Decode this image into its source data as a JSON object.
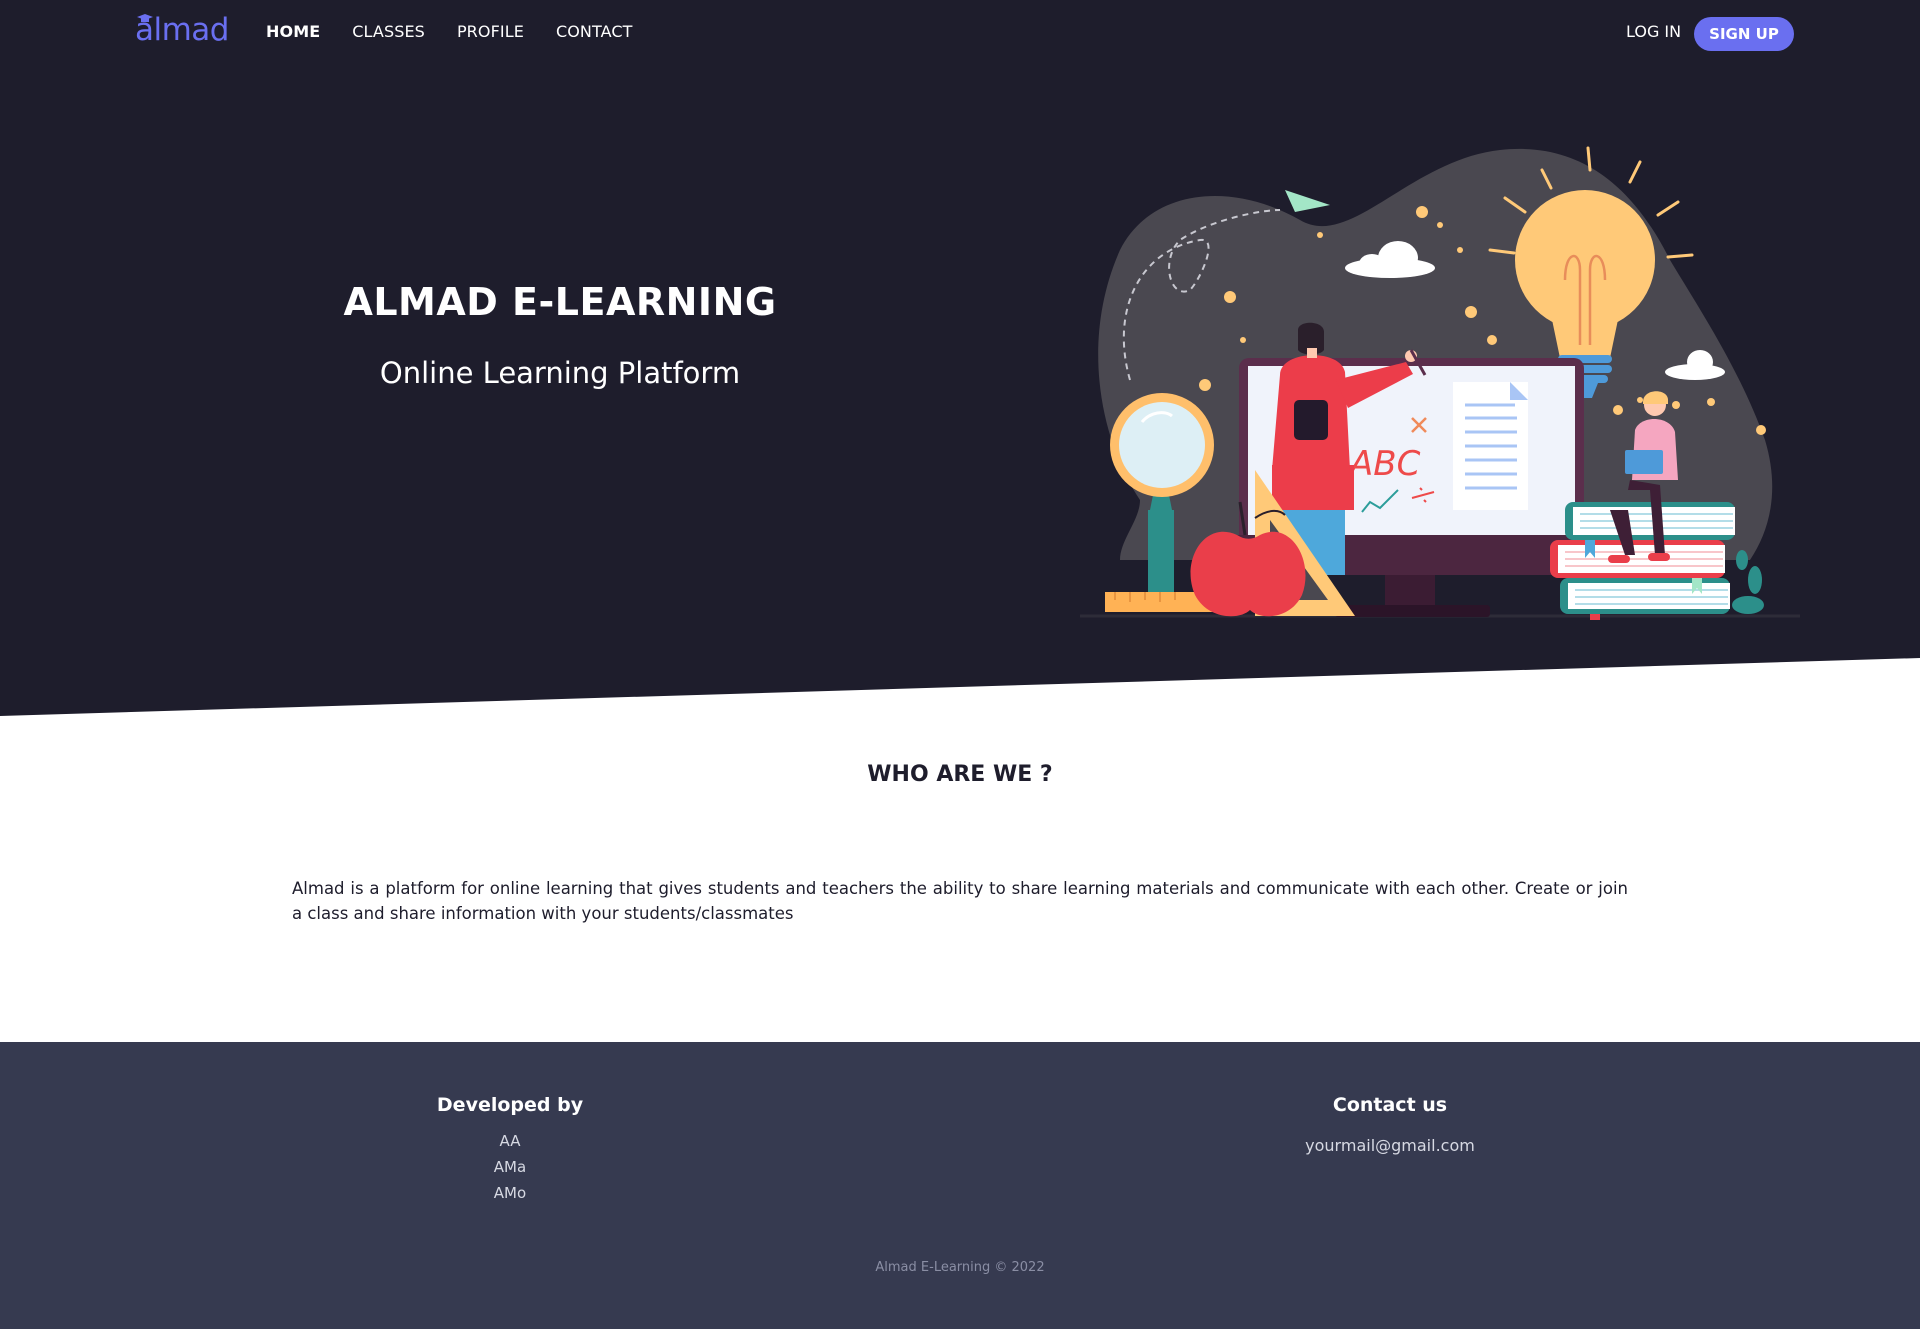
{
  "brand": {
    "logo_text": "almad"
  },
  "nav": {
    "links": [
      {
        "label": "HOME",
        "active": true
      },
      {
        "label": "CLASSES",
        "active": false
      },
      {
        "label": "PROFILE",
        "active": false
      },
      {
        "label": "CONTACT",
        "active": false
      }
    ],
    "login_label": "LOG IN",
    "signup_label": "SIGN UP"
  },
  "hero": {
    "title": "ALMAD E-LEARNING",
    "subtitle": "Online Learning Platform",
    "illustration_text": "ABC"
  },
  "about": {
    "heading": "WHO ARE WE ?",
    "text": "Almad is a platform for online learning that gives students and teachers the ability to share learning materials and communicate with each other. Create or join a class and share information with your students/classmates"
  },
  "footer": {
    "developed_by_title": "Developed by",
    "developers": [
      "AA",
      "AMa",
      "AMo"
    ],
    "contact_title": "Contact us",
    "contact_email": "yourmail@gmail.com",
    "copyright": "Almad E-Learning © 2022"
  },
  "colors": {
    "hero_bg": "#1e1d2c",
    "accent": "#6a6ff0",
    "footer_bg": "#363a50"
  }
}
